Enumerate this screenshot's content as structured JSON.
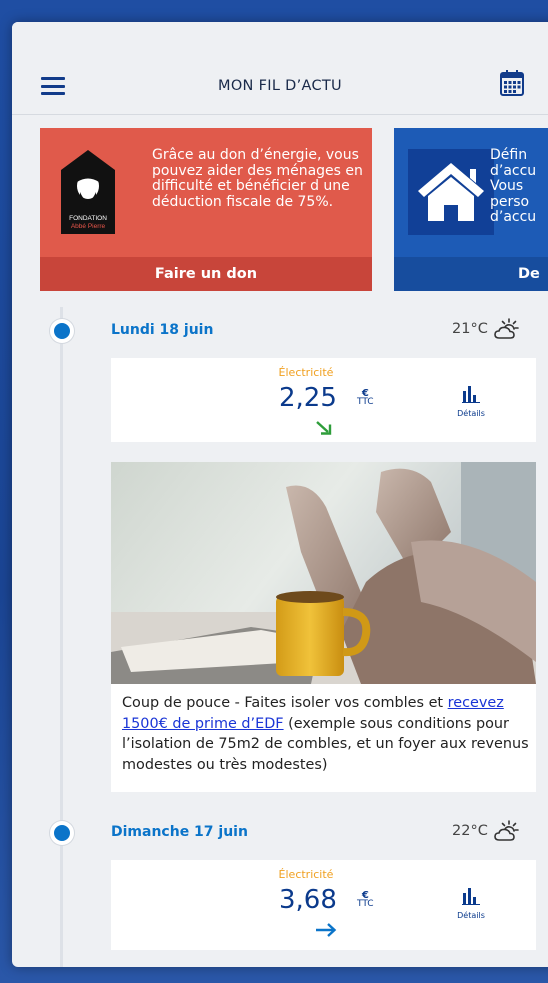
{
  "header": {
    "title": "MON FIL D’ACTU"
  },
  "banners": [
    {
      "logo_line1": "FONDATION",
      "logo_line2": "Abbé Pierre",
      "message": "Grâce au don d’énergie, vous pouvez aider des ménages en difficulté et bénéficier d une déduction fiscale de 75%.",
      "button": "Faire un don",
      "color": "#e05a4b"
    },
    {
      "message": "Défin\nd’accu\nVous\nperso\nd’accu",
      "button": "De",
      "color": "#1d5bb6"
    }
  ],
  "feed": [
    {
      "day": "Lundi 18 juin",
      "temperature": "21°C",
      "weather_icon": "partly-cloudy-icon",
      "energy_label": "Électricité",
      "price": "2,25",
      "currency": "€",
      "tax": "TTC",
      "trend_icon": "arrow-down-right-icon",
      "trend_color": "#2e9d3a",
      "details_label": "Détails"
    },
    {
      "day": "Dimanche 17 juin",
      "temperature": "22°C",
      "weather_icon": "partly-cloudy-icon",
      "energy_label": "Électricité",
      "price": "3,68",
      "currency": "€",
      "tax": "TTC",
      "trend_icon": "arrow-right-icon",
      "trend_color": "#0b74c9",
      "details_label": "Détails"
    }
  ],
  "article": {
    "text_before": "Coup de pouce - Faites isoler vos combles et ",
    "link": "recevez 1500€ de prime d’EDF",
    "text_after": " (exemple sous conditions pour l’isolation de 75m2 de combles, et un foyer aux revenus modestes ou très modestes)"
  }
}
